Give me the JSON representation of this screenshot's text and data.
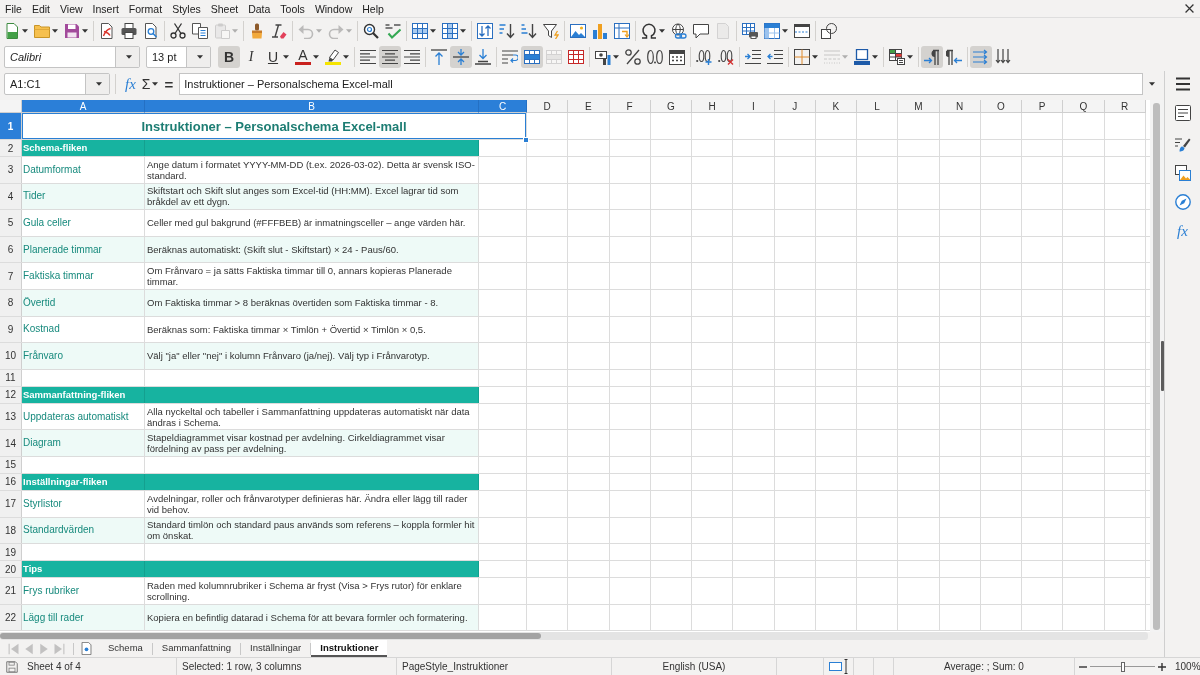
{
  "menu_bar": {
    "items": [
      "File",
      "Edit",
      "View",
      "Insert",
      "Format",
      "Styles",
      "Sheet",
      "Data",
      "Tools",
      "Window",
      "Help"
    ]
  },
  "standard_toolbar": {
    "buttons": [
      {
        "disabled": false
      },
      {
        "disabled": false
      },
      {
        "disabled": false
      },
      {
        "disabled": false
      },
      {
        "disabled": false
      },
      {
        "disabled": false
      },
      {
        "disabled": false
      },
      {
        "disabled": false
      },
      {
        "disabled": true
      },
      {
        "disabled": false
      },
      {
        "disabled": false
      },
      {
        "disabled": true
      },
      {
        "disabled": true
      },
      {
        "disabled": false
      },
      {
        "disabled": false
      },
      {
        "disabled": false
      },
      {
        "disabled": false
      },
      {
        "disabled": false
      },
      {
        "disabled": false
      },
      {
        "disabled": false
      },
      {
        "disabled": false
      },
      {
        "disabled": false
      },
      {
        "disabled": false
      },
      {
        "disabled": false
      },
      {
        "disabled": false
      },
      {
        "disabled": false
      },
      {
        "disabled": false
      },
      {
        "disabled": true
      },
      {
        "disabled": false
      },
      {
        "disabled": false
      },
      {
        "disabled": false
      },
      {
        "disabled": false
      }
    ]
  },
  "formatting_toolbar": {
    "font_name": "Calibri",
    "font_size": "13 pt",
    "buttons": [
      {
        "label": "B",
        "on": true,
        "disabled": false
      },
      {
        "label": "I",
        "on": false,
        "disabled": false
      },
      {
        "label": "U",
        "on": false,
        "disabled": false
      },
      {
        "label": "A",
        "on": false,
        "disabled": false
      },
      {
        "on": false,
        "disabled": false
      },
      {
        "on": false,
        "disabled": false
      },
      {
        "on": true,
        "disabled": false
      },
      {
        "on": false,
        "disabled": false
      },
      {
        "on": false,
        "disabled": false
      },
      {
        "on": true,
        "disabled": false
      },
      {
        "on": false,
        "disabled": false
      },
      {
        "on": false,
        "disabled": false
      },
      {
        "on": true,
        "disabled": false
      },
      {
        "on": false,
        "disabled": true
      },
      {
        "on": false,
        "disabled": false
      },
      {
        "on": false,
        "disabled": false
      },
      {
        "on": false,
        "disabled": false
      },
      {
        "on": false,
        "disabled": false
      },
      {
        "on": false,
        "disabled": false
      },
      {
        "on": false,
        "disabled": false
      },
      {
        "on": false,
        "disabled": false
      },
      {
        "on": false,
        "disabled": false
      },
      {
        "on": false,
        "disabled": false
      },
      {
        "on": false,
        "disabled": false
      },
      {
        "on": false,
        "disabled": true
      },
      {
        "on": false,
        "disabled": false
      },
      {
        "on": false,
        "disabled": false
      },
      {
        "on": true,
        "disabled": false
      },
      {
        "on": false,
        "disabled": false
      },
      {
        "on": true,
        "disabled": false
      },
      {
        "on": false,
        "disabled": false
      }
    ]
  },
  "formula_bar": {
    "name_box": "A1:C1",
    "function_wizard": "fx",
    "sum": "Σ",
    "equals": "=",
    "content": "Instruktioner – Personalschema Excel-mall"
  },
  "sheet": {
    "columns": [
      {
        "label": "A",
        "selected": true
      },
      {
        "label": "B",
        "selected": true
      },
      {
        "label": "C",
        "selected": true
      },
      {
        "label": "D",
        "selected": false
      },
      {
        "label": "E",
        "selected": false
      },
      {
        "label": "F",
        "selected": false
      },
      {
        "label": "G",
        "selected": false
      },
      {
        "label": "H",
        "selected": false
      },
      {
        "label": "I",
        "selected": false
      },
      {
        "label": "J",
        "selected": false
      },
      {
        "label": "K",
        "selected": false
      },
      {
        "label": "L",
        "selected": false
      },
      {
        "label": "M",
        "selected": false
      },
      {
        "label": "N",
        "selected": false
      },
      {
        "label": "O",
        "selected": false
      },
      {
        "label": "P",
        "selected": false
      },
      {
        "label": "Q",
        "selected": false
      },
      {
        "label": "R",
        "selected": false
      }
    ],
    "rows": [
      {
        "number": "1",
        "selected": true,
        "kind": "title",
        "shaded": false,
        "cells": [
          "Instruktioner – Personalschema Excel-mall"
        ]
      },
      {
        "number": "2",
        "selected": false,
        "kind": "section",
        "shaded": false,
        "cells": [
          "Schema-fliken"
        ]
      },
      {
        "number": "3",
        "selected": false,
        "kind": "entry",
        "shaded": false,
        "cells": [
          "Datumformat",
          "Ange datum i formatet YYYY-MM-DD (t.ex. 2026-03-02). Detta är svensk ISO-standard."
        ]
      },
      {
        "number": "4",
        "selected": false,
        "kind": "entry",
        "shaded": true,
        "cells": [
          "Tider",
          "Skiftstart och Skift slut anges som Excel-tid (HH:MM). Excel lagrar tid som bråkdel av ett dygn."
        ]
      },
      {
        "number": "5",
        "selected": false,
        "kind": "entry",
        "shaded": false,
        "cells": [
          "Gula celler",
          "Celler med gul bakgrund (#FFFBEB) är inmatningsceller – ange värden här."
        ]
      },
      {
        "number": "6",
        "selected": false,
        "kind": "entry",
        "shaded": true,
        "cells": [
          "Planerade timmar",
          "Beräknas automatiskt: (Skift slut - Skiftstart) × 24 - Paus/60."
        ]
      },
      {
        "number": "7",
        "selected": false,
        "kind": "entry",
        "shaded": false,
        "cells": [
          "Faktiska timmar",
          "Om Frånvaro = ja sätts Faktiska timmar till 0, annars kopieras Planerade timmar."
        ]
      },
      {
        "number": "8",
        "selected": false,
        "kind": "entry",
        "shaded": true,
        "cells": [
          "Övertid",
          "Om Faktiska timmar > 8 beräknas övertiden som Faktiska timmar - 8."
        ]
      },
      {
        "number": "9",
        "selected": false,
        "kind": "entry",
        "shaded": false,
        "cells": [
          "Kostnad",
          "Beräknas som: Faktiska timmar × Timlön + Övertid × Timlön × 0,5."
        ]
      },
      {
        "number": "10",
        "selected": false,
        "kind": "entry",
        "shaded": true,
        "cells": [
          "Frånvaro",
          "Välj \"ja\" eller \"nej\" i kolumn Frånvaro (ja/nej). Välj typ i Frånvarotyp."
        ]
      },
      {
        "number": "11",
        "selected": false,
        "kind": "blank",
        "shaded": false
      },
      {
        "number": "12",
        "selected": false,
        "kind": "section",
        "shaded": false,
        "cells": [
          "Sammanfattning-fliken"
        ]
      },
      {
        "number": "13",
        "selected": false,
        "kind": "entry",
        "shaded": false,
        "cells": [
          "Uppdateras automatiskt",
          "Alla nyckeltal och tabeller i Sammanfattning uppdateras automatiskt när data ändras i Schema."
        ]
      },
      {
        "number": "14",
        "selected": false,
        "kind": "entry",
        "shaded": true,
        "cells": [
          "Diagram",
          "Stapeldiagrammet visar kostnad per avdelning. Cirkeldiagrammet visar fördelning av pass per avdelning."
        ]
      },
      {
        "number": "15",
        "selected": false,
        "kind": "blank",
        "shaded": false
      },
      {
        "number": "16",
        "selected": false,
        "kind": "section",
        "shaded": false,
        "cells": [
          "Inställningar-fliken"
        ]
      },
      {
        "number": "17",
        "selected": false,
        "kind": "entry",
        "shaded": false,
        "cells": [
          "Styrlistor",
          "Avdelningar, roller och frånvarotyper definieras här. Ändra eller lägg till rader vid behov."
        ]
      },
      {
        "number": "18",
        "selected": false,
        "kind": "entry",
        "shaded": true,
        "cells": [
          "Standardvärden",
          "Standard timlön och standard paus används som referens – koppla formler hit om önskat."
        ]
      },
      {
        "number": "19",
        "selected": false,
        "kind": "blank",
        "shaded": false
      },
      {
        "number": "20",
        "selected": false,
        "kind": "section",
        "shaded": false,
        "cells": [
          "Tips"
        ]
      },
      {
        "number": "21",
        "selected": false,
        "kind": "entry",
        "shaded": false,
        "cells": [
          "Frys rubriker",
          "Raden med kolumnrubriker i Schema är fryst (Visa > Frys rutor) för enklare scrollning."
        ]
      },
      {
        "number": "22",
        "selected": false,
        "kind": "entry",
        "shaded": true,
        "cells": [
          "Lägg till rader",
          "Kopiera en befintlig datarad i Schema för att bevara formler och formatering."
        ]
      }
    ]
  },
  "sheet_tabs": {
    "navigation": [
      {
        "disabled": true
      },
      {
        "disabled": true
      },
      {
        "disabled": true
      },
      {
        "disabled": true
      }
    ],
    "tabs": [
      {
        "label": "Schema",
        "selected": false
      },
      {
        "label": "Sammanfattning",
        "selected": false
      },
      {
        "label": "Inställningar",
        "selected": false
      },
      {
        "label": "Instruktioner",
        "selected": true
      }
    ]
  },
  "sidebar": {
    "functions": "fx"
  },
  "status_bar": {
    "sheet": "Sheet 4 of 4",
    "selection": "Selected: 1 row, 3 columns",
    "page_style": "PageStyle_Instruktioner",
    "language": "English (USA)",
    "summary": "Average: ; Sum: 0",
    "zoom": {
      "level": 0.5,
      "reading": "100%"
    }
  }
}
